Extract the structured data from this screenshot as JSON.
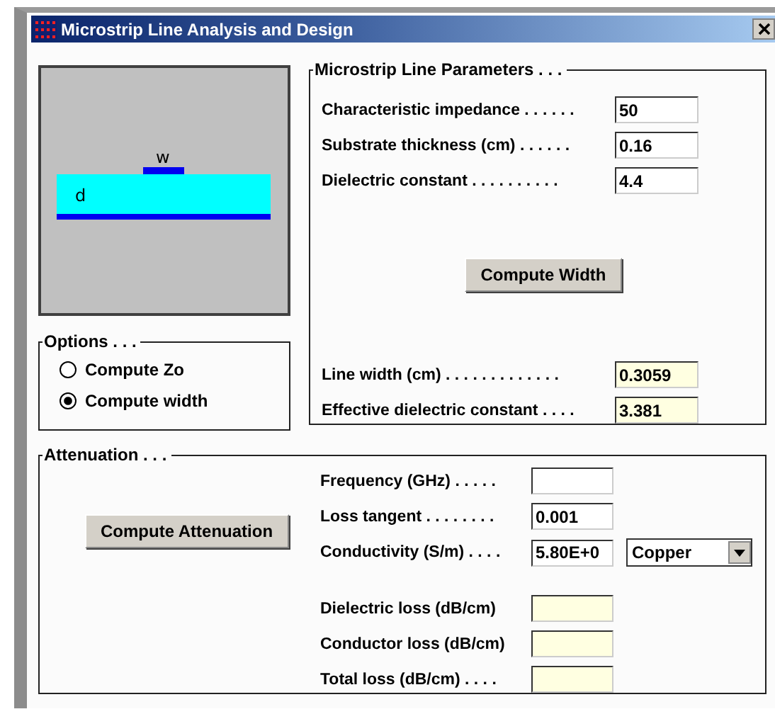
{
  "window": {
    "title": "Microstrip Line Analysis and Design"
  },
  "diagram": {
    "width_label": "w",
    "thickness_label": "d"
  },
  "parameters": {
    "title": "Microstrip Line Parameters . . .",
    "inputs": [
      {
        "label": "Characteristic impedance . . . . . .",
        "value": "50"
      },
      {
        "label": "Substrate thickness (cm) . . . . . .",
        "value": "0.16"
      },
      {
        "label": "Dielectric constant . . . . . . . . . .",
        "value": "4.4"
      }
    ],
    "button": "Compute Width",
    "outputs": [
      {
        "label": "Line width (cm) . . . . . . . . . . . . .",
        "value": "0.3059"
      },
      {
        "label": "Effective dielectric constant . . . .",
        "value": "3.381"
      }
    ]
  },
  "options": {
    "title": "Options . . .",
    "items": [
      {
        "label": "Compute Zo",
        "selected": false
      },
      {
        "label": "Compute width",
        "selected": true
      }
    ]
  },
  "attenuation": {
    "title": "Attenuation . . .",
    "button": "Compute Attenuation",
    "inputs": [
      {
        "label": "Frequency (GHz) . . . . ."
      },
      {
        "label": "Loss tangent . . . . . . . .",
        "value": "0.001"
      },
      {
        "label": "Conductivity (S/m) . . . .",
        "value": "5.80E+0",
        "dropdown": "Copper"
      }
    ],
    "outputs": [
      {
        "label": "Dielectric loss (dB/cm)"
      },
      {
        "label": "Conductor loss (dB/cm)"
      },
      {
        "label": "Total loss (dB/cm) . . . ."
      }
    ]
  }
}
